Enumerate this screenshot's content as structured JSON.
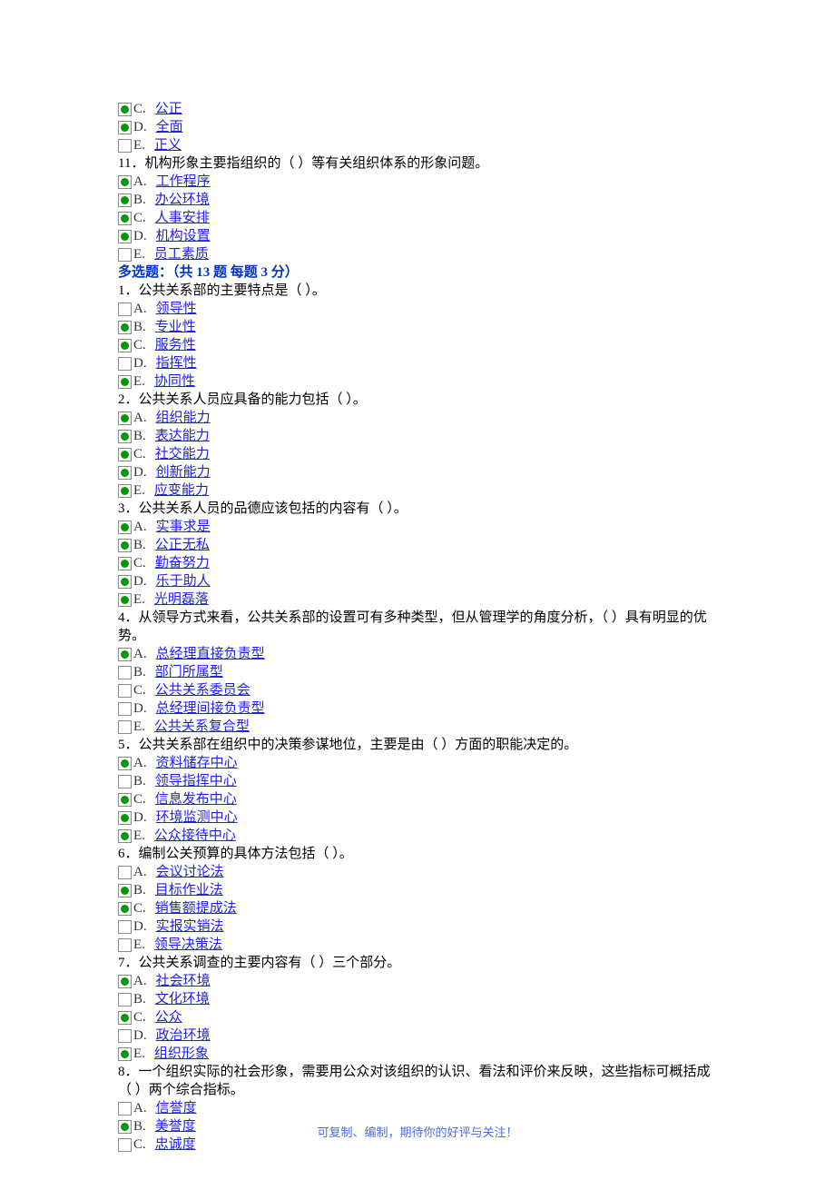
{
  "prelude_options": [
    {
      "letter": "C",
      "text": "公正",
      "on": true
    },
    {
      "letter": "D",
      "text": "全面",
      "on": true
    },
    {
      "letter": "E",
      "text": "正义",
      "on": false
    }
  ],
  "q11": {
    "stem": "11．机构形象主要指组织的（  ）等有关组织体系的形象问题。",
    "options": [
      {
        "letter": "A",
        "text": "工作程序",
        "on": true
      },
      {
        "letter": "B",
        "text": "办公环境",
        "on": true
      },
      {
        "letter": "C",
        "text": "人事安排",
        "on": true
      },
      {
        "letter": "D",
        "text": "机构设置",
        "on": true
      },
      {
        "letter": "E",
        "text": "员工素质",
        "on": false
      }
    ]
  },
  "section": {
    "label": "多选题：（共 13 题  每题 3 分）"
  },
  "multi": [
    {
      "stem": "1．公共关系部的主要特点是（ ）。",
      "options": [
        {
          "letter": "A",
          "text": "领导性",
          "on": false
        },
        {
          "letter": "B",
          "text": "专业性",
          "on": true
        },
        {
          "letter": "C",
          "text": "服务性",
          "on": true
        },
        {
          "letter": "D",
          "text": "指挥性",
          "on": false
        },
        {
          "letter": "E",
          "text": "协同性",
          "on": true
        }
      ]
    },
    {
      "stem": "2．公共关系人员应具备的能力包括（  ）。",
      "options": [
        {
          "letter": "A",
          "text": "组织能力",
          "on": true
        },
        {
          "letter": "B",
          "text": "表达能力",
          "on": true
        },
        {
          "letter": "C",
          "text": "社交能力",
          "on": true
        },
        {
          "letter": "D",
          "text": "创新能力",
          "on": true
        },
        {
          "letter": "E",
          "text": "应变能力",
          "on": true
        }
      ]
    },
    {
      "stem": "3．公共关系人员的品德应该包括的内容有（ ）。",
      "options": [
        {
          "letter": "A",
          "text": "实事求是",
          "on": true
        },
        {
          "letter": "B",
          "text": "公正无私",
          "on": true
        },
        {
          "letter": "C",
          "text": "勤奋努力",
          "on": true
        },
        {
          "letter": "D",
          "text": "乐于助人",
          "on": true
        },
        {
          "letter": "E",
          "text": "光明磊落",
          "on": true
        }
      ]
    },
    {
      "stem": "4．从领导方式来看，公共关系部的设置可有多种类型，但从管理学的角度分析，（  ）具有明显的优势。",
      "options": [
        {
          "letter": "A",
          "text": "总经理直接负责型",
          "on": true
        },
        {
          "letter": "B",
          "text": "部门所属型",
          "on": false
        },
        {
          "letter": "C",
          "text": "公共关系委员会",
          "on": false
        },
        {
          "letter": "D",
          "text": "总经理间接负责型",
          "on": false
        },
        {
          "letter": "E",
          "text": "公共关系复合型",
          "on": false
        }
      ]
    },
    {
      "stem": "5．公共关系部在组织中的决策参谋地位，主要是由（  ）方面的职能决定的。",
      "options": [
        {
          "letter": "A",
          "text": "资料储存中心",
          "on": true
        },
        {
          "letter": "B",
          "text": "领导指挥中心",
          "on": false
        },
        {
          "letter": "C",
          "text": "信息发布中心",
          "on": true
        },
        {
          "letter": "D",
          "text": "环境监测中心",
          "on": true
        },
        {
          "letter": "E",
          "text": "公众接待中心",
          "on": true
        }
      ]
    },
    {
      "stem": "6．编制公关预算的具体方法包括（  ）。",
      "options": [
        {
          "letter": "A",
          "text": "会议讨论法",
          "on": false
        },
        {
          "letter": "B",
          "text": "目标作业法",
          "on": true
        },
        {
          "letter": "C",
          "text": "销售额提成法",
          "on": true
        },
        {
          "letter": "D",
          "text": "实报实销法",
          "on": false
        },
        {
          "letter": "E",
          "text": "领导决策法",
          "on": false
        }
      ]
    },
    {
      "stem": "7．公共关系调查的主要内容有（  ）三个部分。",
      "options": [
        {
          "letter": "A",
          "text": "社会环境",
          "on": true
        },
        {
          "letter": "B",
          "text": "文化环境",
          "on": false
        },
        {
          "letter": "C",
          "text": "公众",
          "on": true
        },
        {
          "letter": "D",
          "text": "政治环境",
          "on": false
        },
        {
          "letter": "E",
          "text": "组织形象",
          "on": true
        }
      ]
    },
    {
      "stem": "8．一个组织实际的社会形象，需要用公众对该组织的认识、看法和评价来反映，这些指标可概括成（  ）两个综合指标。",
      "options": [
        {
          "letter": "A",
          "text": "信誉度",
          "on": false
        },
        {
          "letter": "B",
          "text": "美誉度",
          "on": true
        },
        {
          "letter": "C",
          "text": "忠诚度",
          "on": false
        }
      ]
    }
  ],
  "footer": "可复制、编制，期待你的好评与关注！"
}
